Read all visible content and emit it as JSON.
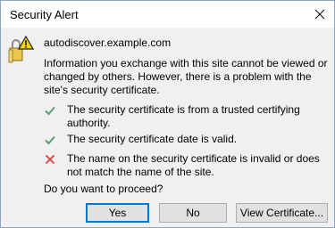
{
  "window": {
    "title": "Security Alert"
  },
  "dialog": {
    "host": "autodiscover.example.com",
    "info": "Information you exchange with this site cannot be viewed or changed by others. However, there is a problem with the site's security certificate.",
    "checks": [
      {
        "status": "ok",
        "icon": "checkmark-icon",
        "text": "The security certificate is from a trusted certifying authority."
      },
      {
        "status": "ok",
        "icon": "checkmark-icon",
        "text": "The security certificate date is valid."
      },
      {
        "status": "error",
        "icon": "red-x-icon",
        "text": "The name on the security certificate is invalid or does not match the name of the site."
      }
    ],
    "question": "Do you want to proceed?"
  },
  "buttons": {
    "yes": "Yes",
    "no": "No",
    "view_certificate": "View Certificate..."
  },
  "colors": {
    "check_green": "#5a9e6e",
    "error_red": "#d9534f",
    "focus_blue": "#0078d7"
  }
}
